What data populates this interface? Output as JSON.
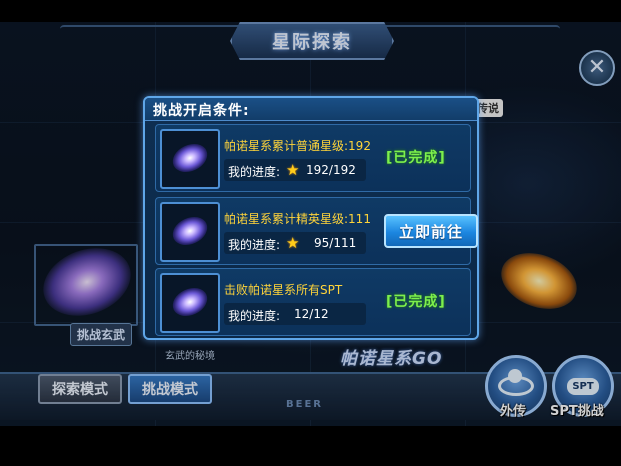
{
  "header": {
    "title": "星际探索",
    "close_icon": "close-icon"
  },
  "background": {
    "legend_tag": "传说",
    "challenge_xuanwu_label": "挑战玄武",
    "xuanwu_secret_label": "玄武的秘境",
    "pano_go_label": "帕诺星系GO",
    "beer_label": "BEER"
  },
  "bottom_nav": {
    "explore_mode_label": "探索模式",
    "challenge_mode_label": "挑战模式",
    "waizhuan_label": "外传",
    "spt_challenge_label": "SPT挑战",
    "spt_badge_text": "SPT"
  },
  "modal": {
    "title": "挑战开启条件:",
    "conditions": [
      {
        "title": "帕诺星系累计普通星级:192",
        "progress_label": "我的进度:",
        "has_star": true,
        "progress_value": "192/192",
        "status": "done",
        "status_text": "[已完成]"
      },
      {
        "title": "帕诺星系累计精英星级:111",
        "progress_label": "我的进度:",
        "has_star": true,
        "progress_value": "95/111",
        "status": "pending",
        "button_label": "立即前往"
      },
      {
        "title": "击败帕诺星系所有SPT",
        "progress_label": "我的进度:",
        "has_star": false,
        "progress_value": "12/12",
        "status": "done",
        "status_text": "[已完成]"
      }
    ]
  },
  "colors": {
    "condition_title": "#ffd43a",
    "done_status": "#7df04c",
    "accent_blue": "#1c86e0",
    "star": "#ffcc1a"
  }
}
